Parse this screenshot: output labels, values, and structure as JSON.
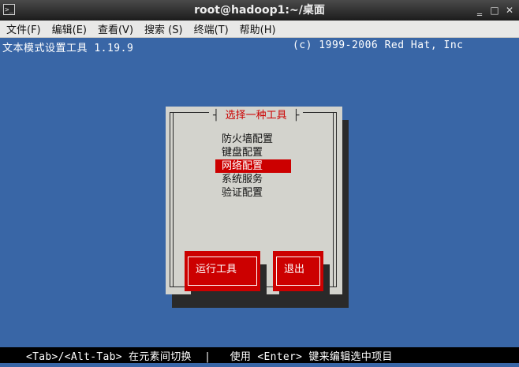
{
  "window": {
    "title": "root@hadoop1:~/桌面",
    "controls": {
      "minimize": "‗",
      "maximize": "□",
      "close": "✕"
    }
  },
  "menubar": {
    "items": [
      {
        "label": "文件(F)"
      },
      {
        "label": "编辑(E)"
      },
      {
        "label": "查看(V)"
      },
      {
        "label": "搜索 (S)"
      },
      {
        "label": "终端(T)"
      },
      {
        "label": "帮助(H)"
      }
    ]
  },
  "terminal": {
    "header_left": "文本模式设置工具 1.19.9",
    "header_right": "(c) 1999-2006 Red Hat, Inc",
    "bottom_hint": "<Tab>/<Alt-Tab> 在元素间切换  |   使用 <Enter> 键来编辑选中项目",
    "colors": {
      "background": "#3966a6",
      "accent": "#cc0000",
      "dialog": "#d3d3cd"
    }
  },
  "dialog": {
    "title": "选择一种工具",
    "items": [
      {
        "label": "防火墙配置",
        "selected": false
      },
      {
        "label": "键盘配置",
        "selected": false
      },
      {
        "label": "网络配置",
        "selected": true
      },
      {
        "label": "系统服务",
        "selected": false
      },
      {
        "label": "验证配置",
        "selected": false
      }
    ],
    "buttons": {
      "run": "运行工具",
      "quit": "退出"
    }
  }
}
